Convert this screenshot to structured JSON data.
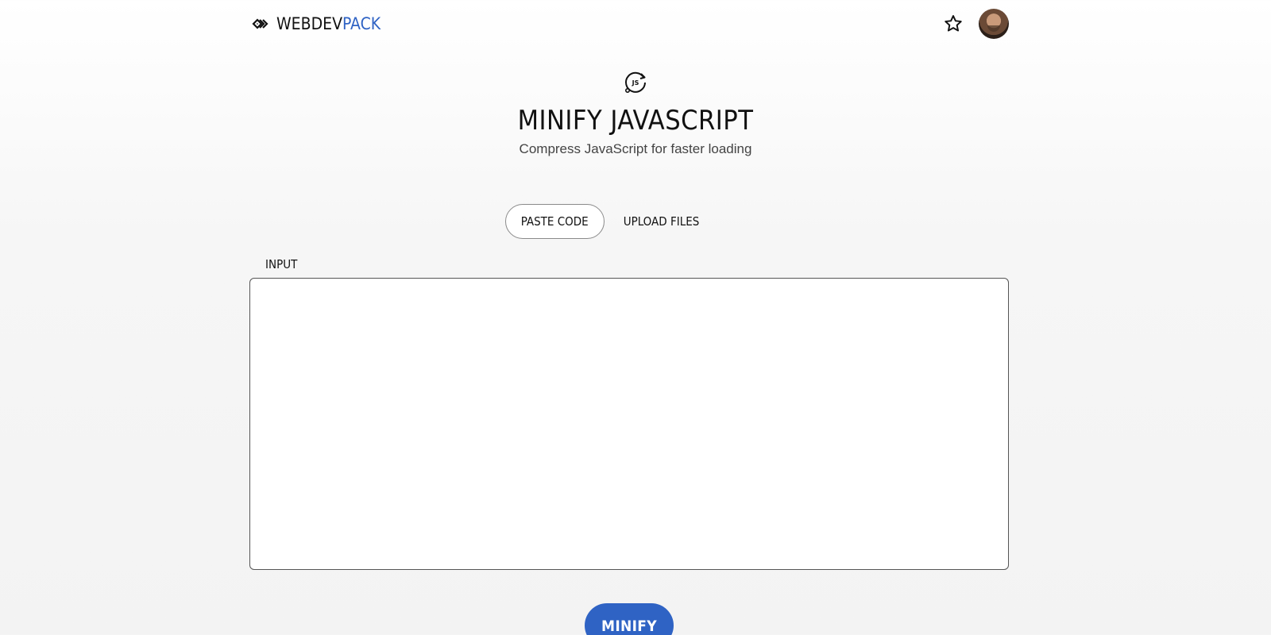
{
  "header": {
    "logo_text_main": "WEBDEV",
    "logo_text_accent": "PACK",
    "logo_icon": "diamond-chevrons-icon",
    "favorite_icon": "star-icon",
    "avatar_icon": "user-avatar"
  },
  "hero": {
    "tool_icon": "js-refresh-icon",
    "tool_icon_text": "JS",
    "title": "MINIFY JAVASCRIPT",
    "subtitle": "Compress JavaScript for faster loading"
  },
  "tabs": [
    {
      "label": "PASTE CODE",
      "active": true
    },
    {
      "label": "UPLOAD FILES",
      "active": false
    }
  ],
  "input": {
    "label": "INPUT",
    "value": "",
    "placeholder": ""
  },
  "actions": {
    "minify_label": "MINIFY"
  },
  "colors": {
    "accent": "#2f63c4",
    "text": "#111111",
    "subtitle": "#444444",
    "border": "#555555"
  }
}
